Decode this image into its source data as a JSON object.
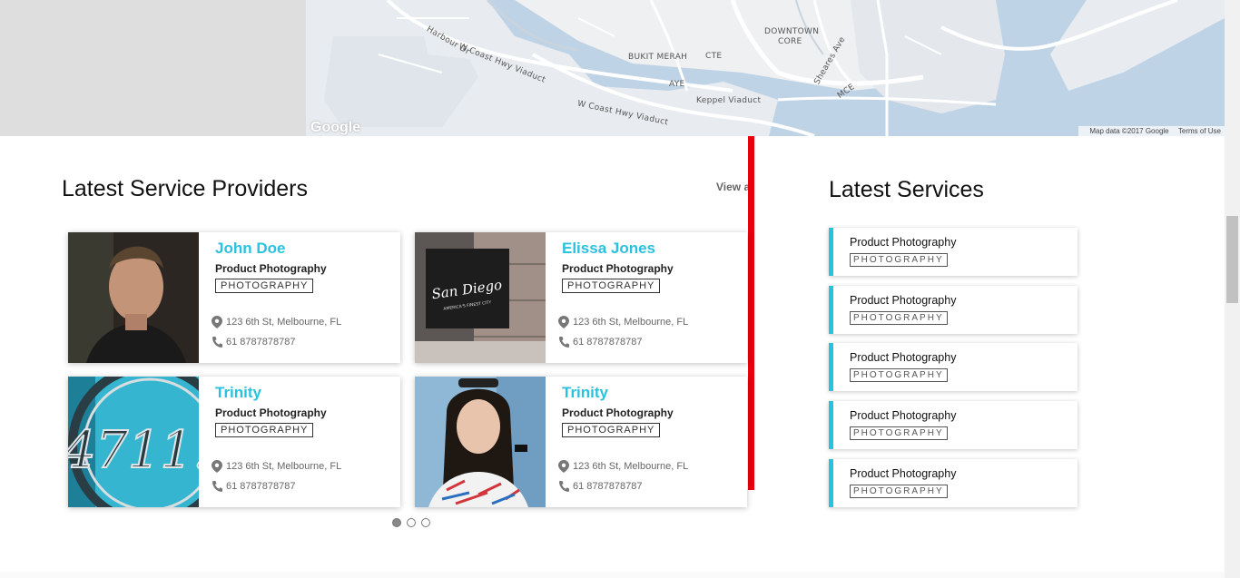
{
  "map": {
    "labels": [
      "DOWNTOWN",
      "CORE",
      "BUKIT MERAH",
      "Keppel Viaduct",
      "W Coast Hwy Viaduct",
      "W Coast Hwy Viaduct",
      "AYE",
      "CTE",
      "MCE",
      "Harbour Dr",
      "Sheares Ave"
    ],
    "logo": "Google",
    "attribution": "Map data ©2017 Google",
    "terms": "Terms of Use"
  },
  "providers": {
    "title": "Latest Service Providers",
    "view_all": "View all",
    "cards": [
      {
        "name": "John Doe",
        "service": "Product Photography",
        "tag": "PHOTOGRAPHY",
        "address": "123 6th St, Melbourne, FL",
        "phone": "61 8787878787"
      },
      {
        "name": "Elissa Jones",
        "service": "Product Photography",
        "tag": "PHOTOGRAPHY",
        "address": "123 6th St, Melbourne, FL",
        "phone": "61 8787878787",
        "sign_text": "San Diego",
        "sign_subtext": "AMERICA'S FINEST CITY"
      },
      {
        "name": "Trinity",
        "service": "Product Photography",
        "tag": "PHOTOGRAPHY",
        "address": "123 6th St, Melbourne, FL",
        "phone": "61 8787878787",
        "sign_text": "4711."
      },
      {
        "name": "Trinity",
        "service": "Product Photography",
        "tag": "PHOTOGRAPHY",
        "address": "123 6th St, Melbourne, FL",
        "phone": "61 8787878787"
      }
    ]
  },
  "services": {
    "title": "Latest Services",
    "items": [
      {
        "name": "Product Photography",
        "tag": "PHOTOGRAPHY"
      },
      {
        "name": "Product Photography",
        "tag": "PHOTOGRAPHY"
      },
      {
        "name": "Product Photography",
        "tag": "PHOTOGRAPHY"
      },
      {
        "name": "Product Photography",
        "tag": "PHOTOGRAPHY"
      },
      {
        "name": "Product Photography",
        "tag": "PHOTOGRAPHY"
      }
    ]
  },
  "colors": {
    "accent": "#29c2de",
    "divider": "#e8000b"
  }
}
